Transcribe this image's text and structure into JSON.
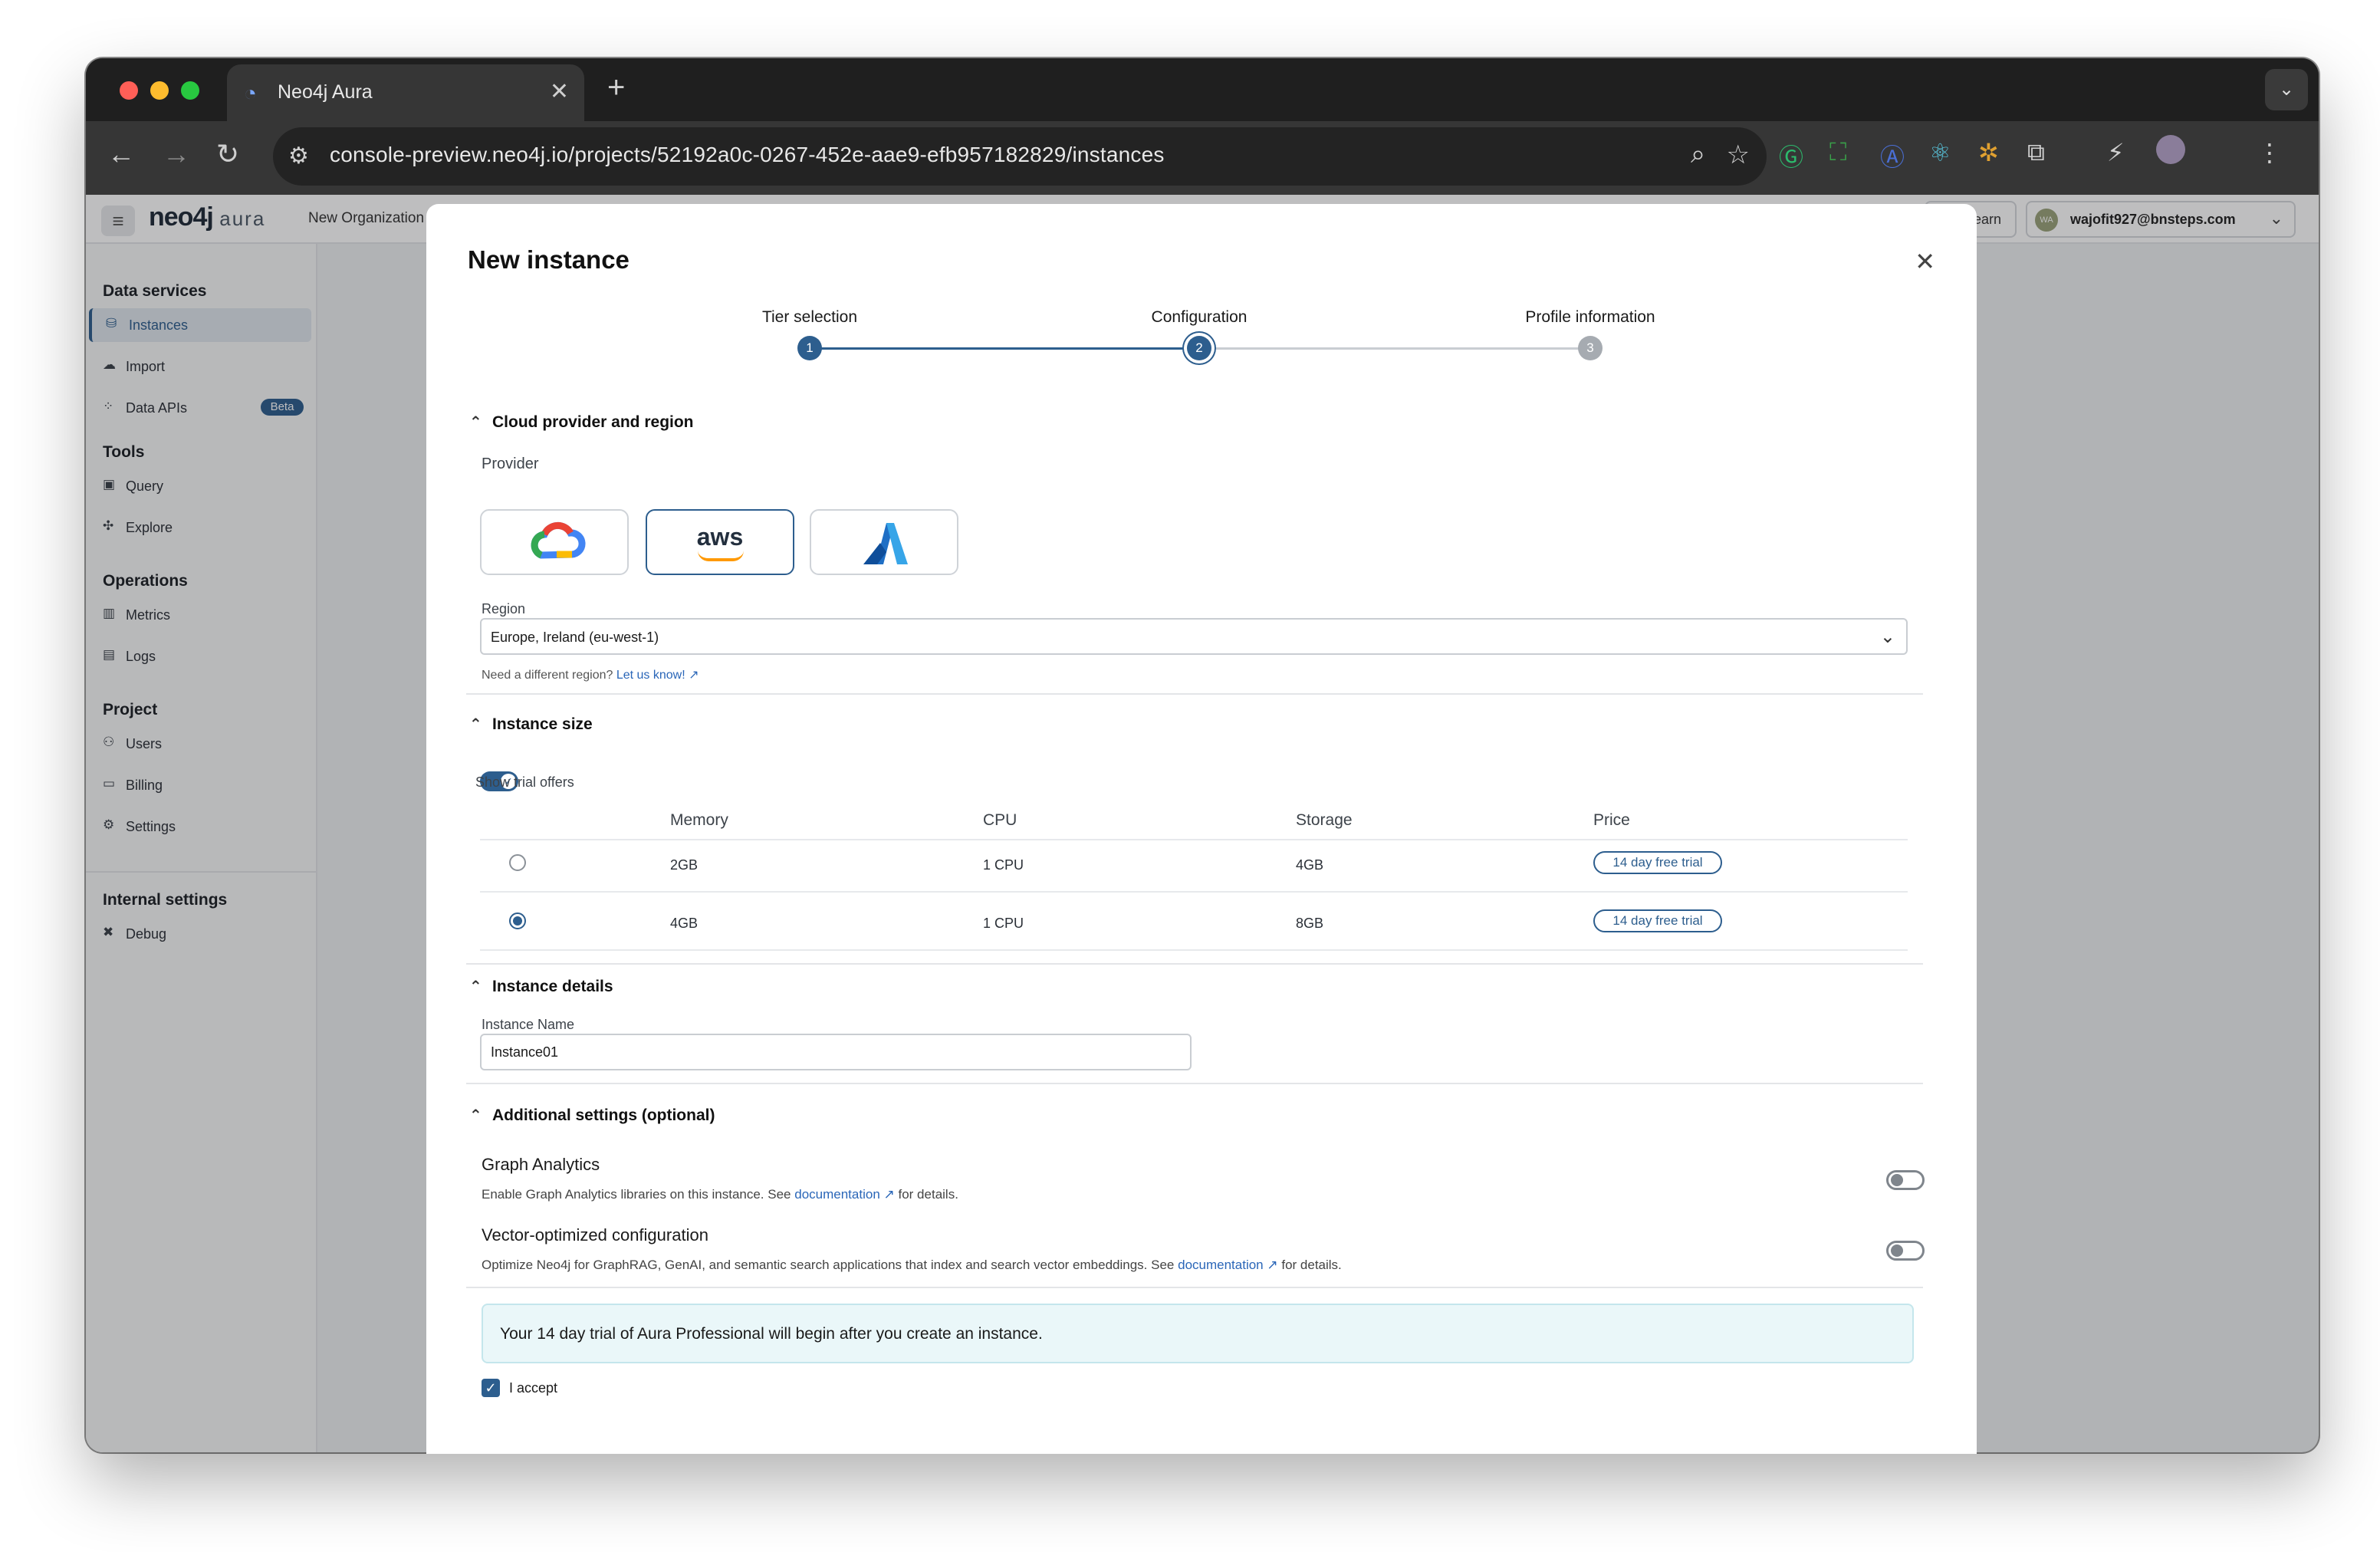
{
  "browser": {
    "tab_title": "Neo4j Aura",
    "url": "console-preview.neo4j.io/projects/52192a0c-0267-452e-aae9-efb957182829/instances",
    "traffic_colors": [
      "#ff5f57",
      "#febc2e",
      "#28c840"
    ]
  },
  "app": {
    "brand": "neo4j",
    "brand_suffix": "aura",
    "org": "New Organization",
    "learn": "Learn",
    "user_initials": "WA",
    "user_email": "wajofit927@bnsteps.com"
  },
  "sidebar": {
    "sections": [
      {
        "title": "Data services"
      },
      {
        "title": "Tools"
      },
      {
        "title": "Operations"
      },
      {
        "title": "Project"
      },
      {
        "title": "Internal settings"
      }
    ],
    "items": [
      {
        "label": "Instances",
        "icon": "database-icon"
      },
      {
        "label": "Import",
        "icon": "cloud-upload-icon"
      },
      {
        "label": "Data APIs",
        "icon": "api-icon",
        "badge": "Beta"
      },
      {
        "label": "Query",
        "icon": "query-icon"
      },
      {
        "label": "Explore",
        "icon": "explore-icon"
      },
      {
        "label": "Metrics",
        "icon": "metrics-icon"
      },
      {
        "label": "Logs",
        "icon": "logs-icon"
      },
      {
        "label": "Users",
        "icon": "users-icon"
      },
      {
        "label": "Billing",
        "icon": "billing-icon"
      },
      {
        "label": "Settings",
        "icon": "settings-icon"
      },
      {
        "label": "Debug",
        "icon": "debug-icon"
      }
    ]
  },
  "modal": {
    "title": "New instance",
    "steps": [
      {
        "label": "Tier selection",
        "num": "1",
        "state": "complete"
      },
      {
        "label": "Configuration",
        "num": "2",
        "state": "current"
      },
      {
        "label": "Profile information",
        "num": "3",
        "state": "upcoming"
      }
    ],
    "cloud": {
      "heading": "Cloud provider and region",
      "provider_label": "Provider",
      "providers": [
        "gcp-logo",
        "aws",
        "azure-logo"
      ],
      "aws_text": "aws",
      "selected_provider": "aws",
      "region_label": "Region",
      "region_value": "Europe, Ireland (eu-west-1)",
      "help_text": "Need a different region?",
      "help_link": "Let us know!"
    },
    "size": {
      "heading": "Instance size",
      "toggle_label": "Show trial offers",
      "toggle_on": true,
      "columns": [
        "Memory",
        "CPU",
        "Storage",
        "Price"
      ],
      "rows": [
        {
          "memory": "2GB",
          "cpu": "1 CPU",
          "storage": "4GB",
          "price": "14 day free trial",
          "selected": false
        },
        {
          "memory": "4GB",
          "cpu": "1 CPU",
          "storage": "8GB",
          "price": "14 day free trial",
          "selected": true
        }
      ]
    },
    "details": {
      "heading": "Instance details",
      "name_label": "Instance Name",
      "name_value": "Instance01"
    },
    "additional": {
      "heading": "Additional settings (optional)",
      "graph_title": "Graph Analytics",
      "graph_desc_pre": "Enable Graph Analytics libraries on this instance. See",
      "graph_link": "documentation",
      "graph_desc_post": "for details.",
      "vector_title": "Vector-optimized configuration",
      "vector_desc_pre": "Optimize Neo4j for GraphRAG, GenAI, and semantic search applications that index and search vector embeddings. See",
      "vector_link": "documentation",
      "vector_desc_post": "for details."
    },
    "banner": "Your 14 day trial of Aura Professional will begin after you create an instance.",
    "accept_label": "I accept",
    "accept_checked": true
  },
  "colors": {
    "accent": "#2d5e8e",
    "link": "#2a66b8"
  }
}
